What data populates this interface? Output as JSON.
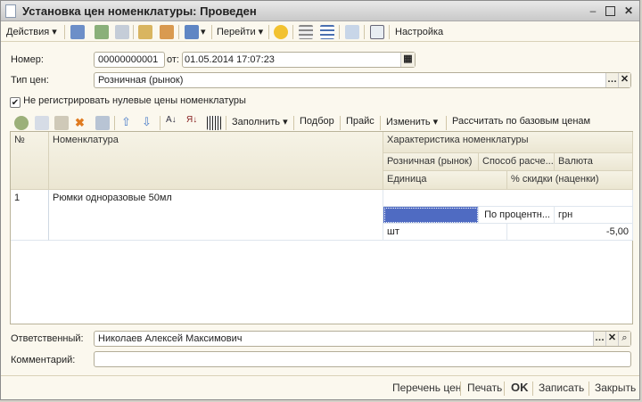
{
  "window": {
    "title": "Установка цен номенклатуры: Проведен"
  },
  "toolbar": {
    "actions": "Действия",
    "goto": "Перейти",
    "settings": "Настройка"
  },
  "form": {
    "number_label": "Номер:",
    "number_value": "00000000001",
    "date_label": "от:",
    "date_value": "01.05.2014 17:07:23",
    "price_type_label": "Тип цен:",
    "price_type_value": "Розничная (рынок)",
    "checkbox_label": "Не регистрировать нулевые цены номенклатуры",
    "checkbox_checked": true,
    "responsible_label": "Ответственный:",
    "responsible_value": "Николаев Алексей Максимович",
    "comment_label": "Комментарий:",
    "comment_value": ""
  },
  "table_toolbar": {
    "fill": "Заполнить",
    "pick": "Подбор",
    "price": "Прайс",
    "change": "Изменить",
    "calc": "Рассчитать по базовым ценам"
  },
  "table": {
    "headers": {
      "num": "№",
      "item": "Номенклатура",
      "characteristic": "Характеристика номенклатуры",
      "retail": "Розничная (рынок)",
      "method": "Способ расче...",
      "currency": "Валюта",
      "unit": "Единица",
      "discount": "% скидки (наценки)"
    },
    "rows": [
      {
        "num": "1",
        "item": "Рюмки одноразовые 50мл",
        "characteristic": "",
        "retail": "",
        "method": "По процентн...",
        "currency": "грн",
        "unit": "шт",
        "discount": "-5,00"
      }
    ]
  },
  "bottom": {
    "price_list": "Перечень цен",
    "print": "Печать",
    "ok": "OK",
    "save": "Записать",
    "close": "Закрыть"
  }
}
